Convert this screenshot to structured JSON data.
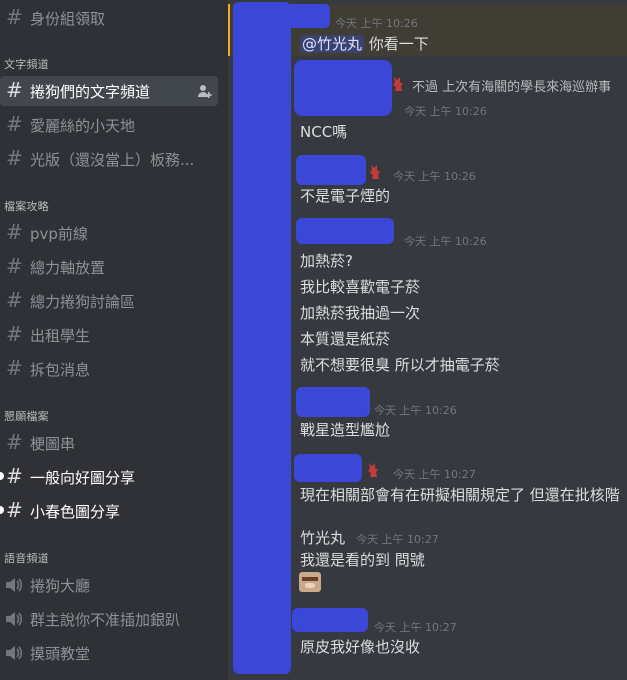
{
  "sidebar": {
    "top_channel": {
      "label": "身份組領取"
    },
    "categories": [
      {
        "label": "文字頻道"
      },
      {
        "label": "檔案攻略"
      },
      {
        "label": "懇願檔案"
      },
      {
        "label": "語音頻道"
      }
    ],
    "channels": [
      {
        "label": "捲狗們的文字頻道"
      },
      {
        "label": "愛麗絲的小天地"
      },
      {
        "label": "光版（還沒當上）板務..."
      },
      {
        "label": "pvp前線"
      },
      {
        "label": "總力軸放置"
      },
      {
        "label": "總力捲狗討論區"
      },
      {
        "label": "出租學生"
      },
      {
        "label": "拆包消息"
      },
      {
        "label": "梗圖串"
      },
      {
        "label": "一般向好圖分享"
      },
      {
        "label": "小春色圖分享"
      },
      {
        "label": "捲狗大廳"
      },
      {
        "label": "群主說你不准插加銀趴"
      },
      {
        "label": "摸頭教堂"
      }
    ]
  },
  "messages": [
    {
      "timestamp": "今天 上午 10:26",
      "mention": "@竹光丸",
      "text": "你看一下"
    },
    {
      "reply_preview": "不過 上次有海關的學長來海巡辦事",
      "timestamp": "今天 上午 10:26",
      "text": "NCC嗎"
    },
    {
      "timestamp": "今天 上午 10:26",
      "text": "不是電子煙的"
    },
    {
      "timestamp": "今天 上午 10:26",
      "lines": [
        "加熱菸?",
        "我比較喜歡電子菸",
        "加熱菸我抽過一次",
        "本質還是紙菸",
        "就不想要很臭 所以才抽電子菸"
      ]
    },
    {
      "timestamp": "今天 上午 10:26",
      "text": "戰星造型尷尬"
    },
    {
      "timestamp": "今天 上午 10:27",
      "text": "現在相關部會有在研擬相關規定了 但還在批核階"
    },
    {
      "author": "竹光丸",
      "timestamp": "今天 上午 10:27",
      "text": "我還是看的到 問號"
    },
    {
      "timestamp": "今天 上午 10:27",
      "text": "原皮我好像也沒收"
    }
  ],
  "colors": {
    "sidebar_bg": "#2f3136",
    "chat_bg": "#36393f",
    "mention_highlight_bg": "#3f3d34",
    "mention_bar": "#faa81a",
    "redaction": "#3b47d6"
  }
}
